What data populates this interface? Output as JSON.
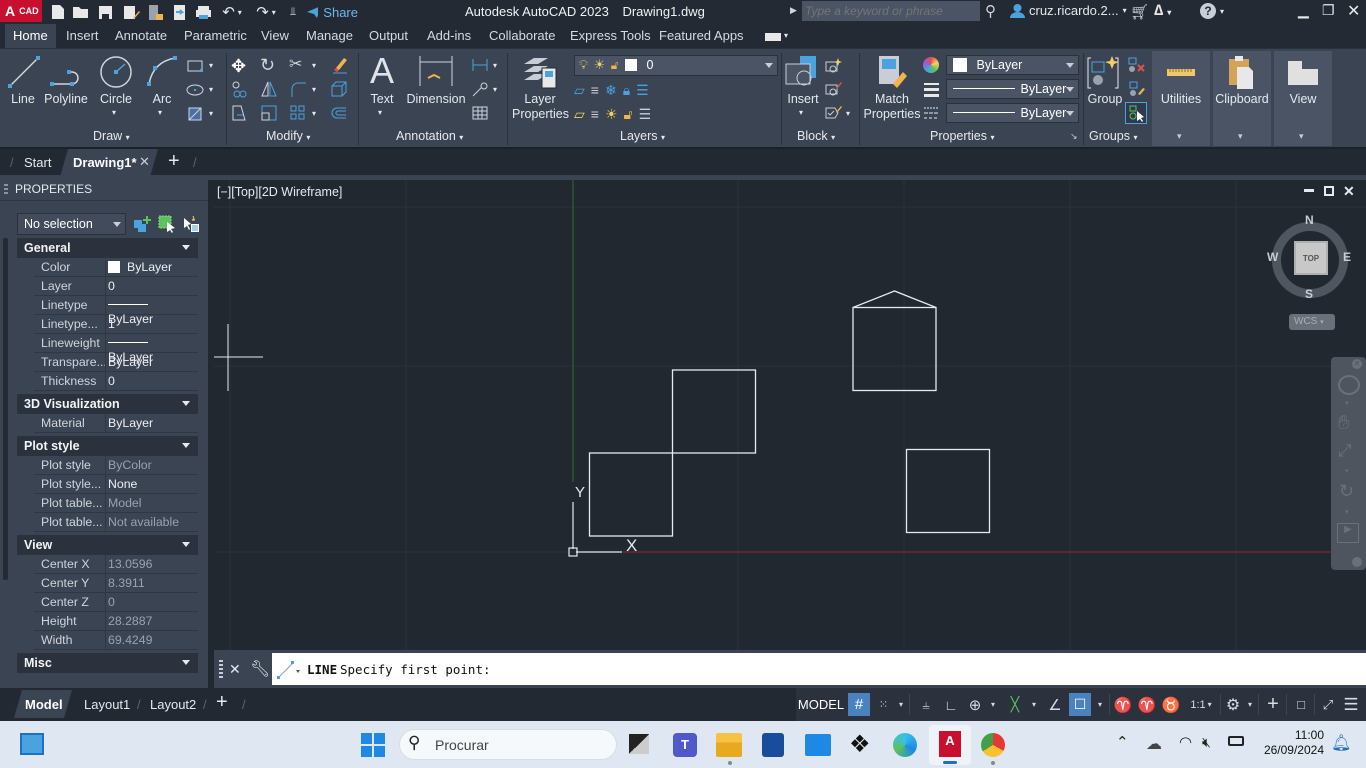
{
  "titlebar": {
    "app_badge": "A",
    "app_badge_sub": "CAD",
    "share_label": "Share",
    "title": "Autodesk AutoCAD 2023",
    "filename": "Drawing1.dwg",
    "search_placeholder": "Type a keyword or phrase",
    "user": "cruz.ricardo.2...",
    "quick_access": [
      "new-icon",
      "open-icon",
      "save-icon",
      "save-as-icon",
      "open-from-web-icon",
      "save-to-web-icon",
      "plot-icon",
      "undo-icon",
      "redo-icon",
      "customize-icon"
    ]
  },
  "ribbon_tabs": [
    "Home",
    "Insert",
    "Annotate",
    "Parametric",
    "View",
    "Manage",
    "Output",
    "Add-ins",
    "Collaborate",
    "Express Tools",
    "Featured Apps"
  ],
  "ribbon_active_tab": "Home",
  "ribbon": {
    "draw": {
      "title": "Draw",
      "line": "Line",
      "polyline": "Polyline",
      "circle": "Circle",
      "arc": "Arc"
    },
    "modify": {
      "title": "Modify"
    },
    "annotation": {
      "title": "Annotation",
      "text": "Text",
      "dimension": "Dimension"
    },
    "layers": {
      "title": "Layers",
      "layer_properties_1": "Layer",
      "layer_properties_2": "Properties",
      "current_layer": "0"
    },
    "block": {
      "title": "Block",
      "insert": "Insert"
    },
    "properties": {
      "title": "Properties",
      "match_1": "Match",
      "match_2": "Properties",
      "color": "ByLayer",
      "lineweight": "ByLayer",
      "linetype": "ByLayer"
    },
    "groups": {
      "title": "Groups",
      "group": "Group"
    },
    "utilities": "Utilities",
    "clipboard": "Clipboard",
    "view": "View"
  },
  "doc_tabs": {
    "start": "Start",
    "active": "Drawing1*"
  },
  "properties_panel": {
    "title": "PROPERTIES",
    "selection": "No selection",
    "sections": {
      "general": {
        "title": "General",
        "rows": [
          {
            "k": "Color",
            "v": "ByLayer"
          },
          {
            "k": "Layer",
            "v": "0"
          },
          {
            "k": "Linetype",
            "v": "ByLayer"
          },
          {
            "k": "Linetype...",
            "v": "1"
          },
          {
            "k": "Lineweight",
            "v": "ByLayer"
          },
          {
            "k": "Transpare...",
            "v": "ByLayer"
          },
          {
            "k": "Thickness",
            "v": "0"
          }
        ]
      },
      "visualization": {
        "title": "3D Visualization",
        "rows": [
          {
            "k": "Material",
            "v": "ByLayer"
          }
        ]
      },
      "plot": {
        "title": "Plot style",
        "rows": [
          {
            "k": "Plot style",
            "v": "ByColor"
          },
          {
            "k": "Plot style...",
            "v": "None"
          },
          {
            "k": "Plot table...",
            "v": "Model"
          },
          {
            "k": "Plot table...",
            "v": "Not available"
          }
        ]
      },
      "view": {
        "title": "View",
        "rows": [
          {
            "k": "Center X",
            "v": "13.0596"
          },
          {
            "k": "Center Y",
            "v": "8.3911"
          },
          {
            "k": "Center Z",
            "v": "0"
          },
          {
            "k": "Height",
            "v": "28.2887"
          },
          {
            "k": "Width",
            "v": "69.4249"
          }
        ]
      },
      "misc": {
        "title": "Misc"
      }
    }
  },
  "viewport": {
    "label": "[−][Top][2D Wireframe]",
    "viewcube": {
      "n": "N",
      "s": "S",
      "e": "E",
      "w": "W",
      "face": "TOP",
      "ucs": "WCS"
    },
    "ucs_x": "X",
    "ucs_y": "Y"
  },
  "command_line": {
    "command": "LINE",
    "prompt": "Specify first point:"
  },
  "layout_tabs": [
    "Model",
    "Layout1",
    "Layout2"
  ],
  "status_bar": {
    "model": "MODEL",
    "scale": "1:1"
  },
  "taskbar": {
    "search": "Procurar",
    "time": "11:00",
    "date": "26/09/2024"
  }
}
